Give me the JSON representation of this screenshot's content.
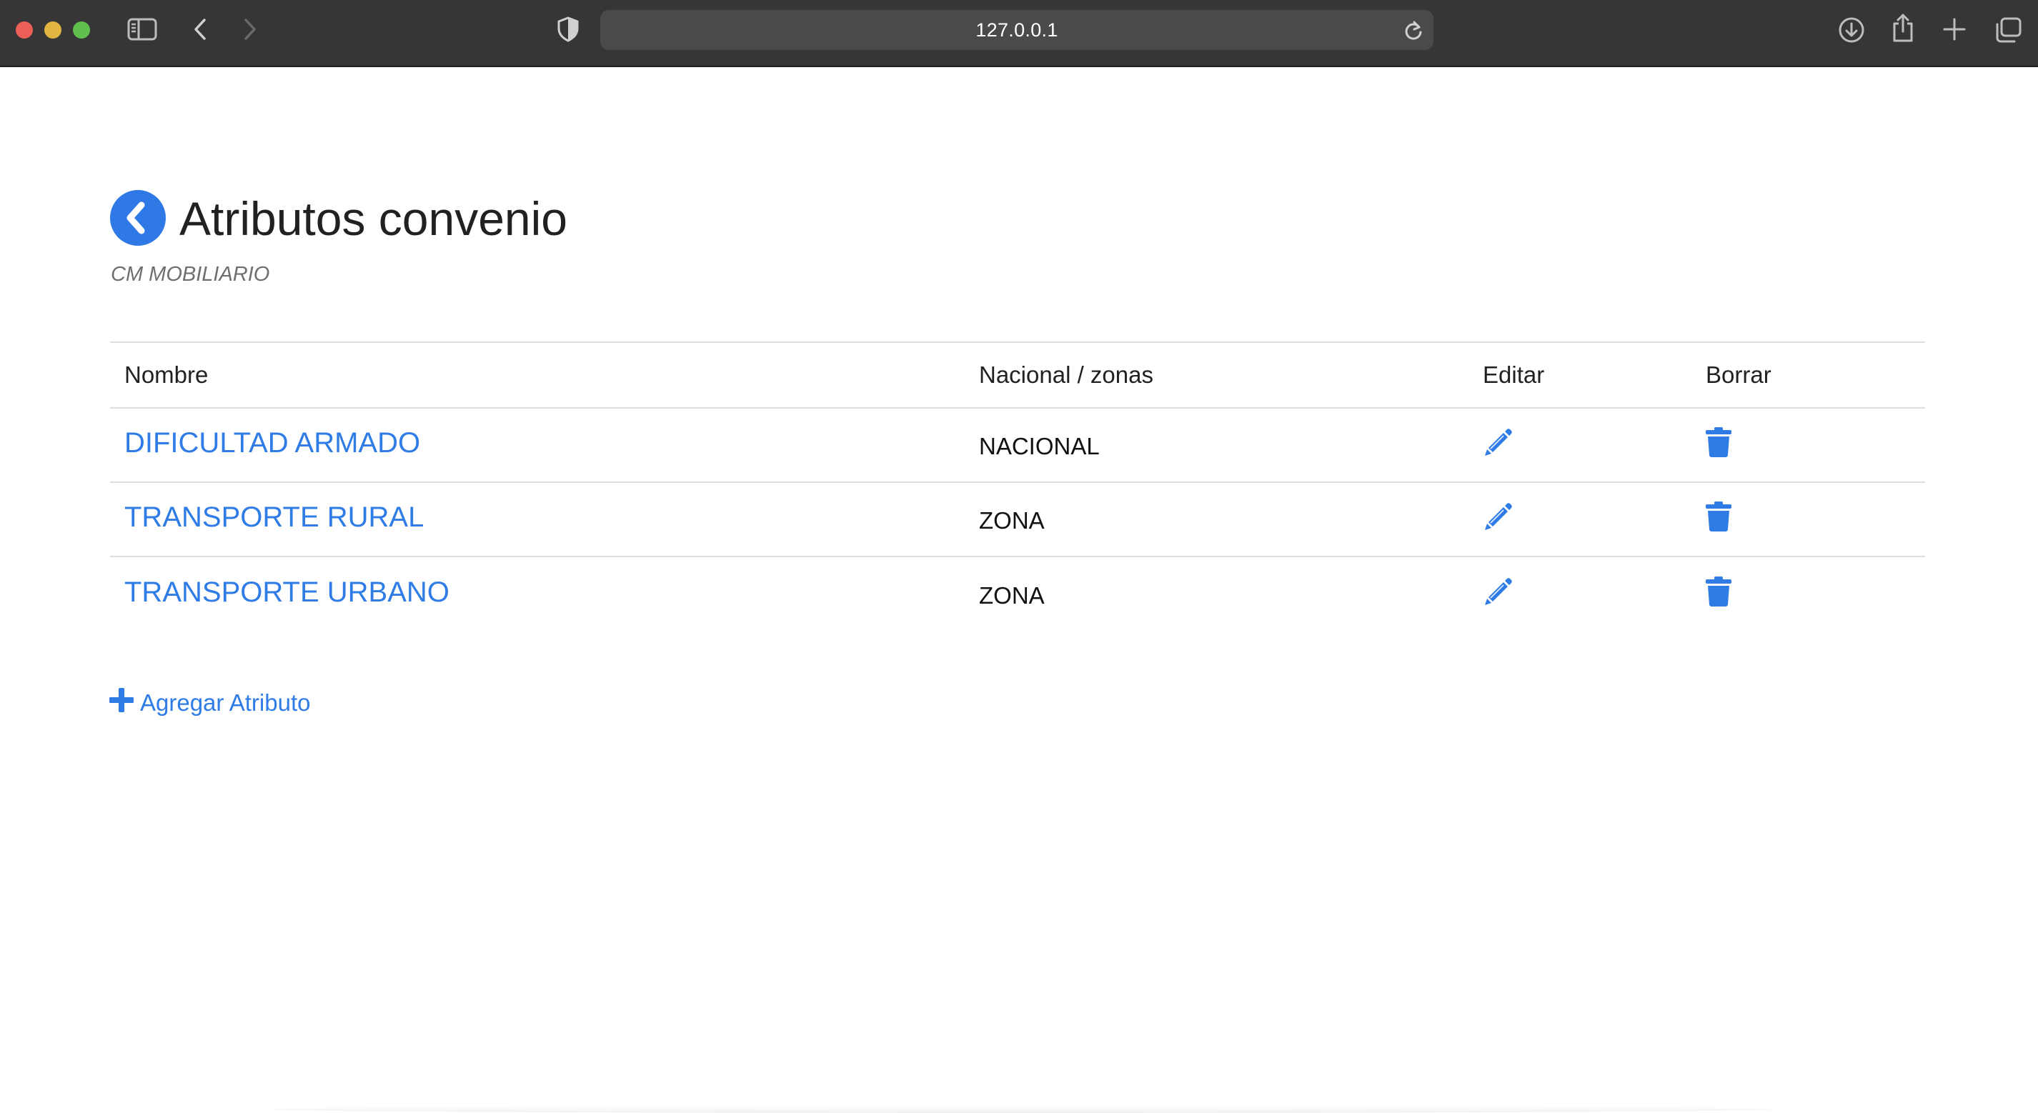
{
  "browser": {
    "url": "127.0.0.1",
    "icons": {
      "sidebar": "sidebar-icon",
      "back": "chevron-left-icon",
      "forward": "chevron-right-icon",
      "privacy": "shield-icon",
      "reload": "reload-icon",
      "downloads": "download-icon",
      "share": "share-icon",
      "new_tab": "plus-icon",
      "tabs": "tab-overview-icon"
    }
  },
  "page": {
    "title": "Atributos convenio",
    "subtitle": "CM MOBILIARIO",
    "accent_color": "#2f7ce6"
  },
  "table": {
    "headers": {
      "name": "Nombre",
      "zone": "Nacional / zonas",
      "edit": "Editar",
      "delete": "Borrar"
    },
    "rows": [
      {
        "name": "DIFICULTAD ARMADO",
        "zone": "NACIONAL"
      },
      {
        "name": "TRANSPORTE RURAL",
        "zone": "ZONA"
      },
      {
        "name": "TRANSPORTE URBANO",
        "zone": "ZONA"
      }
    ]
  },
  "actions": {
    "add_label": "Agregar Atributo"
  }
}
